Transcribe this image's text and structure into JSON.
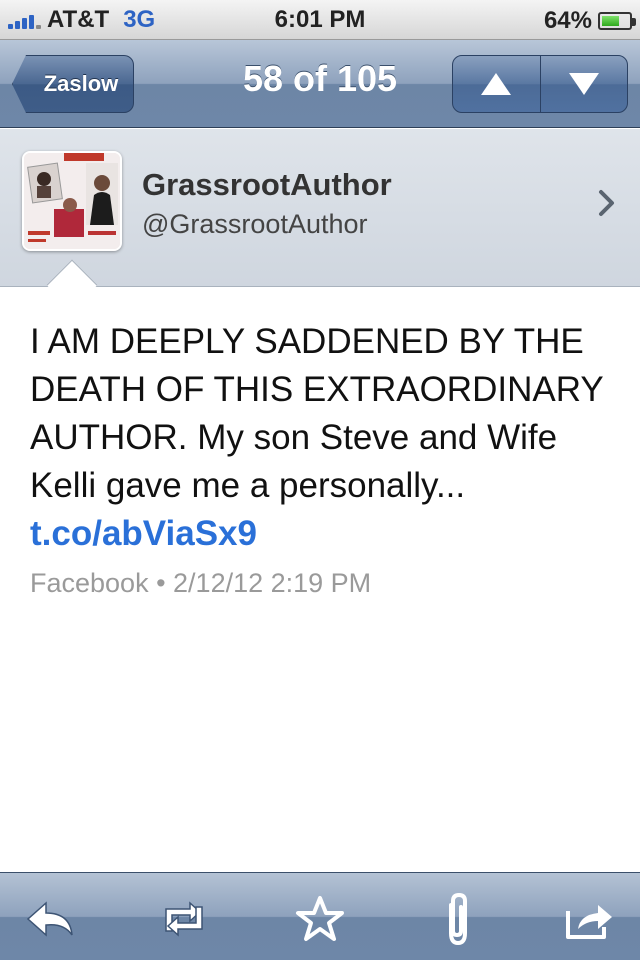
{
  "status_bar": {
    "carrier": "AT&T",
    "network": "3G",
    "time": "6:01 PM",
    "battery_percent": "64%",
    "battery_level": 0.64,
    "accent_color": "#2d63c4"
  },
  "nav": {
    "back_label": "Zaslow",
    "title": "58 of 105",
    "prev_icon": "up-arrow-icon",
    "next_icon": "down-arrow-icon"
  },
  "profile": {
    "display_name": "GrassrootAuthor",
    "handle": "@GrassrootAuthor",
    "avatar_icon": "profile-collage-avatar",
    "disclosure_icon": "chevron-right-icon"
  },
  "tweet": {
    "text": "I AM DEEPLY SADDENED BY THE DEATH OF THIS EXTRAORDINARY AUTHOR. My son Steve and Wife Kelli gave me a personally... ",
    "link": "t.co/abViaSx9",
    "link_color": "#2a70d8",
    "meta": "Facebook • 2/12/12 2:19 PM"
  },
  "toolbar": {
    "items": [
      "reply-icon",
      "retweet-icon",
      "favorite-star-icon",
      "attachment-paperclip-icon",
      "share-icon"
    ]
  }
}
